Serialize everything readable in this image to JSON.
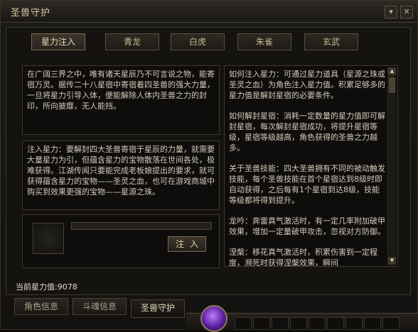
{
  "window": {
    "title": "圣兽守护",
    "min_label": "▾",
    "close_label": "✕"
  },
  "tabs": [
    {
      "label": "星力注入",
      "active": true
    },
    {
      "label": "青龙",
      "active": false
    },
    {
      "label": "白虎",
      "active": false
    },
    {
      "label": "朱雀",
      "active": false
    },
    {
      "label": "玄武",
      "active": false
    }
  ],
  "panels": {
    "intro": "在广阔三界之中，唯有诸天星辰乃不可言说之物，能寄宿万灵。据传二十八星宿中寄宿着四圣兽的强大力量，一旦将星力引导入体，便能解除人体内圣兽之力的封印，所向披靡，无人能挡。",
    "inject_desc": "注入星力：要解封四大圣兽寄宿于星辰的力量，就需要大量星力为引，但蕴含星力的宝物散落在世间各处，极难获得。江湖传闻只要能完成老板娘提出的要求，就可获得蕴含星力的宝物——圣灵之血，也可在游戏商城中购买到效果更强的宝物——星源之珠。",
    "help": [
      "如何注入星力：可通过星力道具（星源之珠或圣灵之血）为角色注入星力值。积累足够多的星力值是解封星宿的必要条件。",
      "如何解封星宿：消耗一定数量的星力值即可解封星宿，每次解封星宿成功，将提升星宿等级，星宿等级越高，角色获得的圣兽之力越多。",
      "关于圣兽技能：四大圣兽拥有不同的被动触发技能，每个圣兽技能在首个星宿达到8级时即自动获得，之后每有1个星宿到达8级，技能等级都将得到提升。",
      "龙吟：奔雷真气激活时，有一定几率附加破甲效果，增加一定量破甲攻击，忽视对方防御。",
      "涅槃：移花真气激活时，积累伤害到一定程度，濒死时获得涅槃效果，瞬间"
    ]
  },
  "inject": {
    "button_label": "注入",
    "progress": 0.0
  },
  "status": {
    "star_power_label": "当前星力值:9078"
  },
  "bottom_tabs": [
    {
      "label": "角色信息",
      "active": false
    },
    {
      "label": "斗魂信息",
      "active": false
    },
    {
      "label": "圣兽守护",
      "active": true
    }
  ],
  "icons": {
    "scroll_up": "▲",
    "scroll_down": "▼"
  },
  "colors": {
    "accent": "#c9b98f",
    "text": "#d2cbbb",
    "orb": "#8b3fd6"
  }
}
